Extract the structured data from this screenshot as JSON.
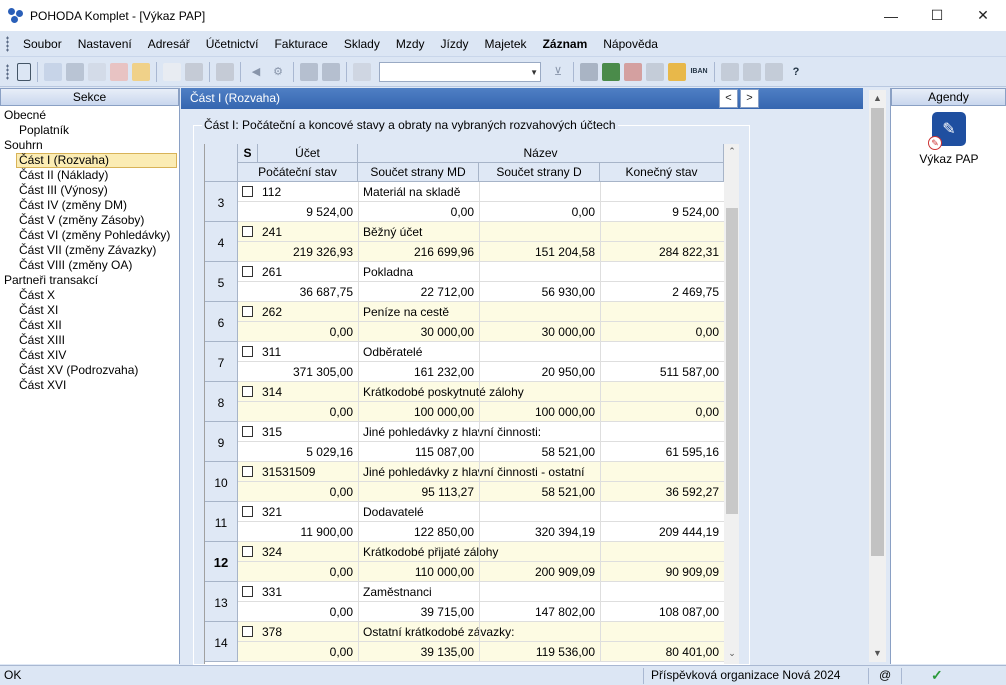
{
  "window": {
    "title": "POHODA Komplet - [Výkaz PAP]",
    "minimize": "—",
    "maximize": "☐",
    "close": "✕"
  },
  "menu": [
    "Soubor",
    "Nastavení",
    "Adresář",
    "Účetnictví",
    "Fakturace",
    "Sklady",
    "Mzdy",
    "Jízdy",
    "Majetek",
    "Záznam",
    "Nápověda"
  ],
  "menu_bold_index": 9,
  "sections": {
    "header": "Sekce",
    "items": [
      {
        "label": "Obecné",
        "level": 0
      },
      {
        "label": "Poplatník",
        "level": 1
      },
      {
        "label": "Souhrn",
        "level": 0
      },
      {
        "label": "Část I (Rozvaha)",
        "level": 1,
        "selected": true
      },
      {
        "label": "Část II (Náklady)",
        "level": 1
      },
      {
        "label": "Část III (Výnosy)",
        "level": 1
      },
      {
        "label": "Část IV (změny DM)",
        "level": 1
      },
      {
        "label": "Část V (změny Zásoby)",
        "level": 1
      },
      {
        "label": "Část VI (změny Pohledávky)",
        "level": 1
      },
      {
        "label": "Část VII (změny Závazky)",
        "level": 1
      },
      {
        "label": "Část VIII (změny OA)",
        "level": 1
      },
      {
        "label": "Partneři transakcí",
        "level": 0
      },
      {
        "label": "Část X",
        "level": 1
      },
      {
        "label": "Část XI",
        "level": 1
      },
      {
        "label": "Část XII",
        "level": 1
      },
      {
        "label": "Část XIII",
        "level": 1
      },
      {
        "label": "Část XIV",
        "level": 1
      },
      {
        "label": "Část XV (Podrozvaha)",
        "level": 1
      },
      {
        "label": "Část XVI",
        "level": 1
      }
    ]
  },
  "main": {
    "header": "Část I (Rozvaha)",
    "prev": "<",
    "next": ">",
    "group_title": "Část I: Počáteční a koncové stavy a obraty na vybraných rozvahových účtech",
    "columns": {
      "s": "S",
      "ucet": "Účet",
      "nazev": "Název",
      "poc": "Počáteční stav",
      "md": "Součet strany MD",
      "d": "Součet strany D",
      "kon": "Konečný stav"
    },
    "current_row": "12",
    "rows": [
      {
        "n": "3",
        "ucet": "112",
        "nazev": "Materiál na skladě",
        "poc": "9 524,00",
        "md": "0,00",
        "d": "0,00",
        "kon": "9 524,00"
      },
      {
        "n": "4",
        "ucet": "241",
        "nazev": "Běžný účet",
        "poc": "219 326,93",
        "md": "216 699,96",
        "d": "151 204,58",
        "kon": "284 822,31"
      },
      {
        "n": "5",
        "ucet": "261",
        "nazev": "Pokladna",
        "poc": "36 687,75",
        "md": "22 712,00",
        "d": "56 930,00",
        "kon": "2 469,75"
      },
      {
        "n": "6",
        "ucet": "262",
        "nazev": "Peníze na cestě",
        "poc": "0,00",
        "md": "30 000,00",
        "d": "30 000,00",
        "kon": "0,00"
      },
      {
        "n": "7",
        "ucet": "311",
        "nazev": "Odběratelé",
        "poc": "371 305,00",
        "md": "161 232,00",
        "d": "20 950,00",
        "kon": "511 587,00"
      },
      {
        "n": "8",
        "ucet": "314",
        "nazev": "Krátkodobé poskytnuté zálohy",
        "poc": "0,00",
        "md": "100 000,00",
        "d": "100 000,00",
        "kon": "0,00"
      },
      {
        "n": "9",
        "ucet": "315",
        "nazev": "Jiné pohledávky z hlavní činnosti:",
        "poc": "5 029,16",
        "md": "115 087,00",
        "d": "58 521,00",
        "kon": "61 595,16"
      },
      {
        "n": "10",
        "ucet": "31531509",
        "nazev": "Jiné pohledávky z hlavní činnosti - ostatní",
        "poc": "0,00",
        "md": "95 113,27",
        "d": "58 521,00",
        "kon": "36 592,27"
      },
      {
        "n": "11",
        "ucet": "321",
        "nazev": "Dodavatelé",
        "poc": "11 900,00",
        "md": "122 850,00",
        "d": "320 394,19",
        "kon": "209 444,19"
      },
      {
        "n": "12",
        "ucet": "324",
        "nazev": "Krátkodobé přijaté zálohy",
        "poc": "0,00",
        "md": "110 000,00",
        "d": "200 909,09",
        "kon": "90 909,09"
      },
      {
        "n": "13",
        "ucet": "331",
        "nazev": "Zaměstnanci",
        "poc": "0,00",
        "md": "39 715,00",
        "d": "147 802,00",
        "kon": "108 087,00"
      },
      {
        "n": "14",
        "ucet": "378",
        "nazev": "Ostatní krátkodobé závazky:",
        "poc": "0,00",
        "md": "39 135,00",
        "d": "119 536,00",
        "kon": "80 401,00"
      }
    ]
  },
  "agendy": {
    "header": "Agendy",
    "item": "Výkaz PAP"
  },
  "status": {
    "left": "OK",
    "org": "Příspěvková organizace Nová 2024",
    "at": "@"
  }
}
